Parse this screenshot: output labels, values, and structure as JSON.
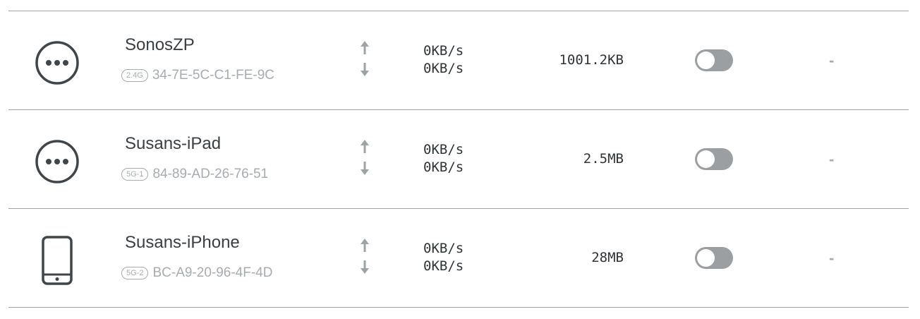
{
  "devices": [
    {
      "name": "SonosZP",
      "icon": "more-dots-icon",
      "band": "2.4G",
      "mac": "34-7E-5C-C1-FE-9C",
      "upload_speed": "0KB/s",
      "download_speed": "0KB/s",
      "usage": "1001.2KB",
      "blocked": false,
      "action": "-"
    },
    {
      "name": "Susans-iPad",
      "icon": "more-dots-icon",
      "band": "5G-1",
      "mac": "84-89-AD-26-76-51",
      "upload_speed": "0KB/s",
      "download_speed": "0KB/s",
      "usage": "2.5MB",
      "blocked": false,
      "action": "-"
    },
    {
      "name": "Susans-iPhone",
      "icon": "smartphone-icon",
      "band": "5G-2",
      "mac": "BC-A9-20-96-4F-4D",
      "upload_speed": "0KB/s",
      "download_speed": "0KB/s",
      "usage": "28MB",
      "blocked": false,
      "action": "-"
    }
  ],
  "colors": {
    "icon": "#3f4548",
    "divider": "#9ea3a6",
    "muted_text": "#a7acaf",
    "toggle_off": "#9b9fa2"
  }
}
